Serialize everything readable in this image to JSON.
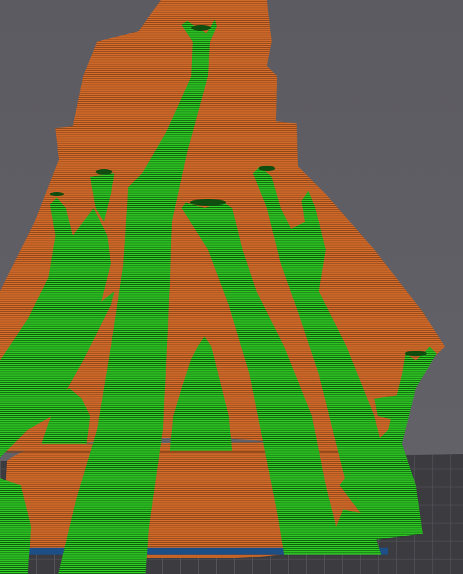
{
  "viewer": {
    "view": "slice-preview",
    "background_color": "#5f5e64",
    "bed_grid_color": "#3a3a3f",
    "bed_line_color": "#55555a",
    "model": {
      "name": "",
      "layer_color": "#d06a2a",
      "layer_line_color": "#8a4318"
    },
    "supports": {
      "type": "tree",
      "layer_color": "#2fc424",
      "layer_line_color": "#0d5c0d"
    },
    "brim_color": "#1d4f86"
  }
}
